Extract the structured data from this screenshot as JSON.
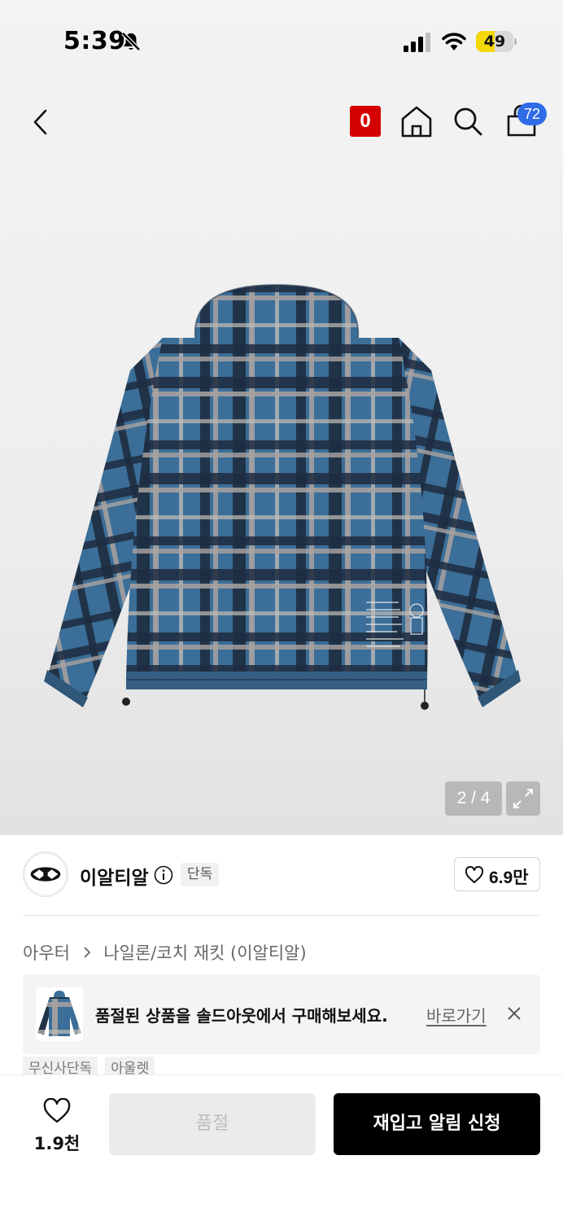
{
  "status_bar": {
    "time": "5:39",
    "battery_percent": "49",
    "battery_level": 0.49
  },
  "top_nav": {
    "brand_button_label": "0",
    "cart_count": "72"
  },
  "gallery": {
    "pager": "2 / 4"
  },
  "brand": {
    "name": "이알티알",
    "badge": "단독",
    "like_count": "6.9만"
  },
  "breadcrumb": {
    "category": "아우터",
    "subcategory": "나일론/코치 재킷 (이알티알)"
  },
  "soldout_banner": {
    "message": "품절된 상품을 솔드아웃에서 구매해보세요.",
    "link_label": "바로가기"
  },
  "tags": [
    "무신사단독",
    "아울렛"
  ],
  "bottom_bar": {
    "wish_count": "1.9천",
    "soldout_label": "품절",
    "restock_label": "재입고 알림 신청"
  },
  "colors": {
    "brand_red": "#d50000",
    "badge_blue": "#2f6ce8",
    "battery_yellow": "#f5d70a",
    "cta_black": "#000000"
  }
}
